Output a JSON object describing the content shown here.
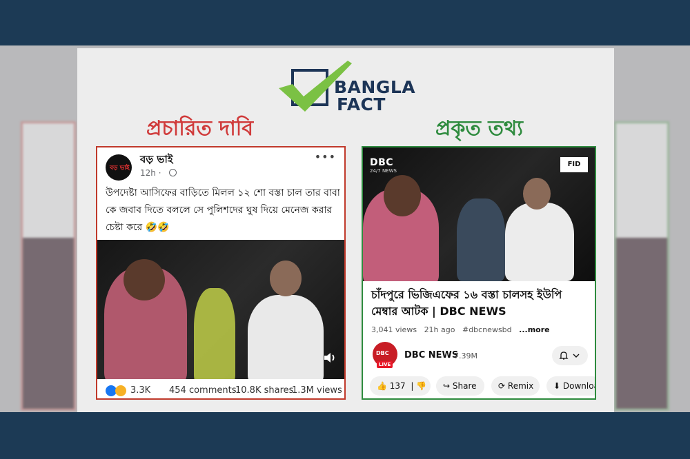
{
  "logo": {
    "word1": "BANGLA",
    "word2": "FACT"
  },
  "headings": {
    "claim": "প্রচারিত দাবি",
    "fact": "প্রকৃত তথ্য"
  },
  "facebook_post": {
    "page_name": "বড় ভাই",
    "avatar_text": "বড় ভাই",
    "time": "12h ·",
    "text": "উপদেষ্টা আসিফের বাড়িতে মিলল ১২ শো বস্তা চাল তার বাবা কে জবাব দিতে বললে সে পুলিশদের ঘুষ দিয়ে মেনেজ করার চেষ্টা করে 🤣🤣",
    "reactions": "3.3K",
    "comments": "454 comments",
    "shares": "10.8K shares",
    "views": "1.3M views"
  },
  "youtube": {
    "channel_brand": "DBC",
    "channel_brand_sub": "24/7 NEWS",
    "fid_logo": "FID",
    "title": "চাঁদপুরে ভিজিএফের ১৬ বস্তা চালসহ ইউপি মেম্বার আটক | DBC NEWS",
    "views": "3,041 views",
    "age": "21h ago",
    "hashtag": "#dbcnewsbd",
    "more": "...more",
    "channel_logo_text": "DBC",
    "live_badge": "LIVE",
    "channel_name": "DBC NEWS",
    "subscribers": "7.39M",
    "likes": "137",
    "share_label": "Share",
    "remix_label": "Remix",
    "download_label": "Downloa"
  },
  "colors": {
    "frame": "#1c3a55",
    "claim_red": "#d03b3b",
    "fact_green": "#2e8b3e",
    "logo_navy": "#1d3557",
    "logo_check": "#7bc144"
  }
}
